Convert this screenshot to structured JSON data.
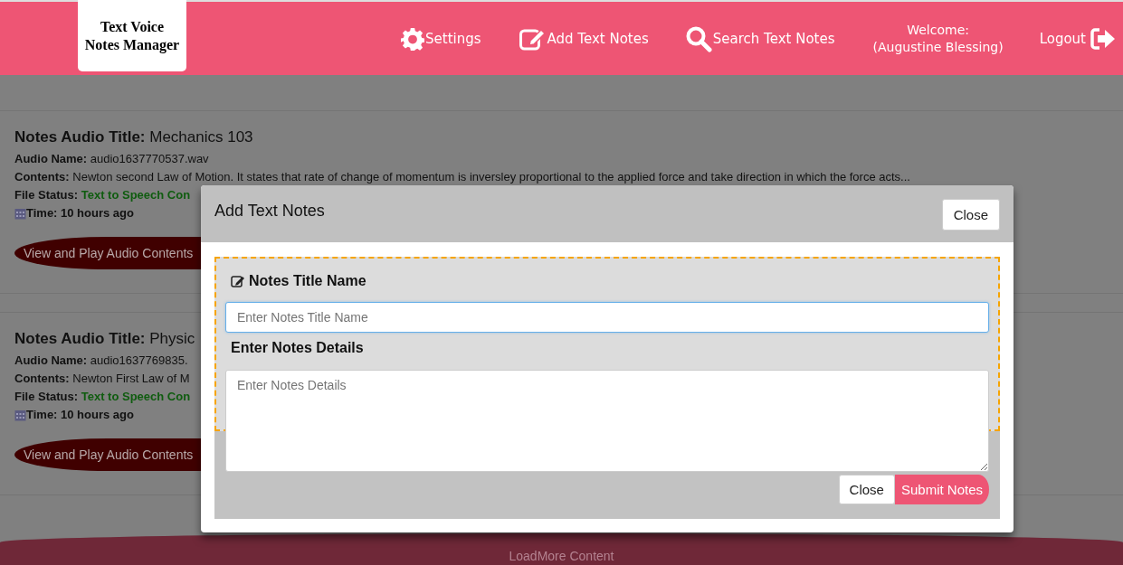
{
  "header": {
    "logo": [
      "Text Voice",
      "Notes Manager"
    ],
    "nav": [
      {
        "kind": "gear",
        "label": "Settings"
      },
      {
        "kind": "edit",
        "label": "Add Text Notes"
      },
      {
        "kind": "search",
        "label": "Search Text Notes"
      }
    ],
    "welcome": {
      "greeting": "Welcome:",
      "user": "(Augustine Blessing)"
    },
    "logout": "Logout"
  },
  "notes": [
    {
      "title_label": "Notes Audio Title:",
      "title": "Mechanics 103",
      "audio_label": "Audio Name:",
      "audio": "audio1637770537.wav",
      "contents_label": "Contents:",
      "contents": "Newton second Law of Motion. It states that rate of change of momentum is inversley proportional to the applied force and take direction in which the force acts...",
      "status_label": "File Status:",
      "status": "Text to Speech Con",
      "time": "Time: 10 hours ago",
      "button": "View and Play Audio Contents"
    },
    {
      "title_label": "Notes Audio Title:",
      "title": "Physic",
      "audio_label": "Audio Name:",
      "audio": "audio1637769835.",
      "contents_label": "Contents:",
      "contents": "Newton First Law of M",
      "status_label": "File Status:",
      "status": "Text to Speech Con",
      "time": "Time: 10 hours ago",
      "button": "View and Play Audio Contents"
    }
  ],
  "load_more": "LoadMore Content",
  "modal": {
    "title": "Add Text Notes",
    "close": "Close",
    "title_field": {
      "label": "Notes Title Name",
      "placeholder": "Enter Notes Title Name",
      "focused": true
    },
    "details_field": {
      "label": "Enter Notes Details",
      "placeholder": "Enter Notes Details",
      "focused": false
    },
    "buttons": [
      {
        "kind": "default",
        "label": "Close"
      },
      {
        "kind": "primary",
        "label": "Submit Notes"
      }
    ]
  }
}
